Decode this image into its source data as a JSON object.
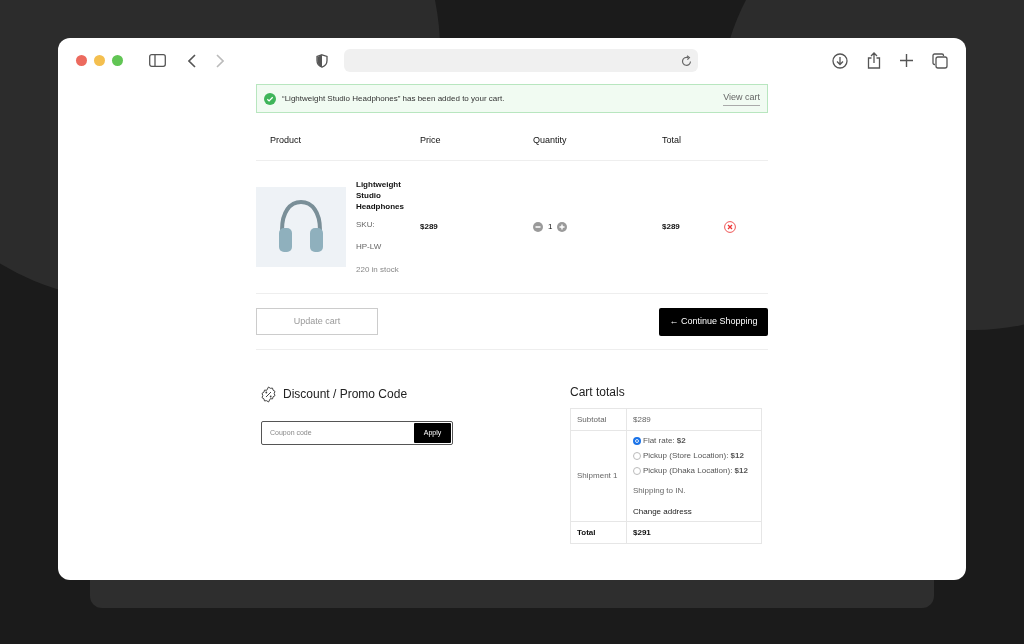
{
  "notice": {
    "message": "“Lightweight Studio Headphones” has been added to your cart.",
    "link": "View cart"
  },
  "cart": {
    "columns": [
      "Product",
      "Price",
      "Quantity",
      "Total"
    ],
    "rows": [
      {
        "name": "Lightweight Studio Headphones",
        "sku_label": "SKU:",
        "sku": "HP-LW",
        "stock": "220 in stock",
        "price": "$289",
        "quantity": "1",
        "total": "$289"
      }
    ]
  },
  "actions": {
    "update": "Update cart",
    "continue": "← Continue Shopping"
  },
  "discount": {
    "title": "Discount / Promo Code",
    "placeholder": "Coupon code",
    "button": "Apply"
  },
  "totals": {
    "title": "Cart totals",
    "subtotal_label": "Subtotal",
    "subtotal": "$289",
    "shipment_label": "Shipment 1",
    "options": [
      {
        "label": "Flat rate: **$2**",
        "selected": true
      },
      {
        "label": "Pickup (Store Location): **$12**",
        "selected": false
      },
      {
        "label": "Pickup (Dhaka Location): **$12**",
        "selected": false
      }
    ],
    "shipping_note": "Shipping to IN.",
    "change_address": "Change address",
    "total_label": "Total",
    "total": "$291"
  }
}
